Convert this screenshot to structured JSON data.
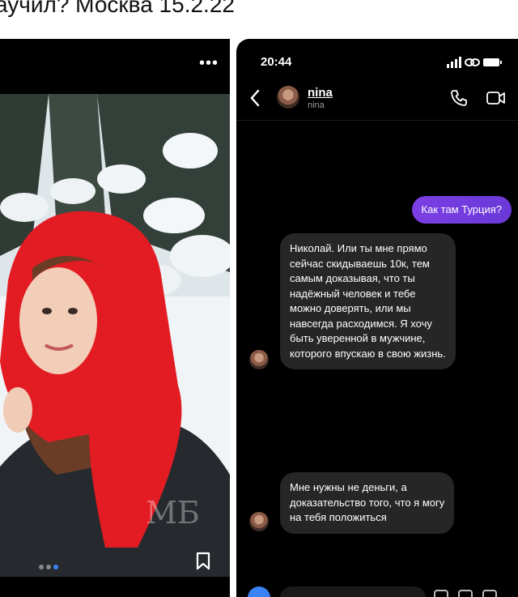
{
  "caption": "аучил? Москва 15.2.22",
  "post": {
    "more_label": "•••",
    "watermark": "МБ"
  },
  "dm": {
    "time": "20:44",
    "contact_name": "nina",
    "contact_handle": "nina",
    "messages": [
      {
        "from": "me",
        "text": "Как там Турция?"
      },
      {
        "from": "nina",
        "lines": [
          "Николай. Или ты мне прямо",
          "сейчас скидываешь 10к, тем",
          "самым доказывая, что ты",
          "надёжный человек и тебе",
          "можно доверять, или мы",
          "навсегда расходимся. Я хочу",
          "быть уверенной в мужчине,",
          "которого впускаю в свою жизнь."
        ]
      },
      {
        "from": "nina",
        "lines": [
          "Мне нужны не деньги, а",
          "доказательство того, что я могу",
          "на тебя положиться"
        ]
      }
    ]
  },
  "colors": {
    "outgoing_bubble": "#7b3fe4",
    "incoming_bubble": "#262626",
    "active_dot": "#3b82f6"
  },
  "icons": [
    "back-icon",
    "phone-icon",
    "video-icon",
    "signal-icon",
    "link-icon",
    "battery-icon",
    "bookmark-icon",
    "more-icon"
  ]
}
